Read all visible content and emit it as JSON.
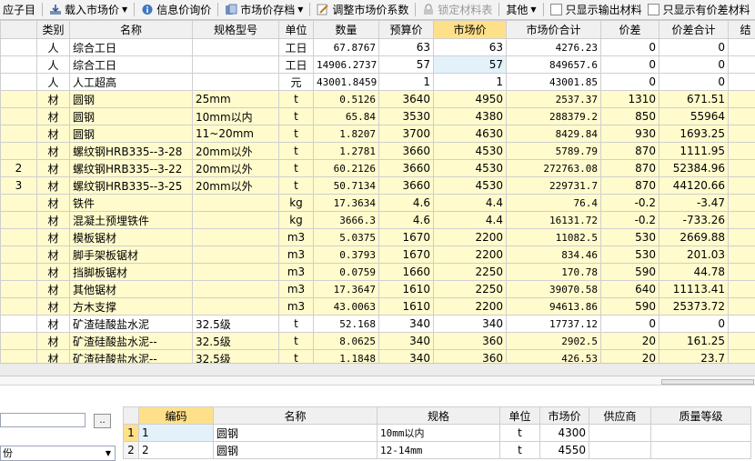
{
  "toolbar": {
    "item_left": "应子目",
    "load_price": "载入市场价",
    "info_price": "信息价询价",
    "market_archive": "市场价存档",
    "adjust_coef": "调整市场价系数",
    "lock_table": "锁定材料表",
    "other": "其他",
    "only_output": "只显示输出材料",
    "only_diff": "只显示有价差材料"
  },
  "grid": {
    "headers": [
      "类别",
      "名称",
      "规格型号",
      "单位",
      "数量",
      "预算价",
      "市场价",
      "市场价合计",
      "价差",
      "价差合计",
      "结"
    ],
    "rows": [
      {
        "lead": "",
        "cat": "人",
        "name": "综合工日",
        "spec": "",
        "unit": "工日",
        "qty": "67.8767",
        "budget": "63",
        "market": "63",
        "total": "4276.23",
        "diff": "0",
        "diff_total": "0",
        "tone": "white"
      },
      {
        "lead": "",
        "cat": "人",
        "name": "综合工日",
        "spec": "",
        "unit": "工日",
        "qty": "14906.2737",
        "budget": "57",
        "market": "57",
        "total": "849657.6",
        "diff": "0",
        "diff_total": "0",
        "tone": "white"
      },
      {
        "lead": "",
        "cat": "人",
        "name": "人工超高",
        "spec": "",
        "unit": "元",
        "qty": "43001.8459",
        "budget": "1",
        "market": "1",
        "total": "43001.85",
        "diff": "0",
        "diff_total": "0",
        "tone": "white"
      },
      {
        "lead": "",
        "cat": "材",
        "name": "圆钢",
        "spec": "25mm",
        "unit": "t",
        "qty": "0.5126",
        "budget": "3640",
        "market": "4950",
        "total": "2537.37",
        "diff": "1310",
        "diff_total": "671.51",
        "tone": "yellow"
      },
      {
        "lead": "",
        "cat": "材",
        "name": "圆钢",
        "spec": "10mm以内",
        "unit": "t",
        "qty": "65.84",
        "budget": "3530",
        "market": "4380",
        "total": "288379.2",
        "diff": "850",
        "diff_total": "55964",
        "tone": "yellow"
      },
      {
        "lead": "",
        "cat": "材",
        "name": "圆钢",
        "spec": "11~20mm",
        "unit": "t",
        "qty": "1.8207",
        "budget": "3700",
        "market": "4630",
        "total": "8429.84",
        "diff": "930",
        "diff_total": "1693.25",
        "tone": "yellow"
      },
      {
        "lead": "",
        "cat": "材",
        "name": "螺纹钢HRB335--3-28",
        "spec": "20mm以外",
        "unit": "t",
        "qty": "1.2781",
        "budget": "3660",
        "market": "4530",
        "total": "5789.79",
        "diff": "870",
        "diff_total": "1111.95",
        "tone": "yellow"
      },
      {
        "lead": "2",
        "cat": "材",
        "name": "螺纹钢HRB335--3-22",
        "spec": "20mm以外",
        "unit": "t",
        "qty": "60.2126",
        "budget": "3660",
        "market": "4530",
        "total": "272763.08",
        "diff": "870",
        "diff_total": "52384.96",
        "tone": "yellow"
      },
      {
        "lead": "3",
        "cat": "材",
        "name": "螺纹钢HRB335--3-25",
        "spec": "20mm以外",
        "unit": "t",
        "qty": "50.7134",
        "budget": "3660",
        "market": "4530",
        "total": "229731.7",
        "diff": "870",
        "diff_total": "44120.66",
        "tone": "yellow"
      },
      {
        "lead": "",
        "cat": "材",
        "name": "铁件",
        "spec": "",
        "unit": "kg",
        "qty": "17.3634",
        "budget": "4.6",
        "market": "4.4",
        "total": "76.4",
        "diff": "-0.2",
        "diff_total": "-3.47",
        "tone": "yellow"
      },
      {
        "lead": "",
        "cat": "材",
        "name": "混凝土预埋铁件",
        "spec": "",
        "unit": "kg",
        "qty": "3666.3",
        "budget": "4.6",
        "market": "4.4",
        "total": "16131.72",
        "diff": "-0.2",
        "diff_total": "-733.26",
        "tone": "yellow"
      },
      {
        "lead": "",
        "cat": "材",
        "name": "模板锯材",
        "spec": "",
        "unit": "m3",
        "qty": "5.0375",
        "budget": "1670",
        "market": "2200",
        "total": "11082.5",
        "diff": "530",
        "diff_total": "2669.88",
        "tone": "yellow"
      },
      {
        "lead": "",
        "cat": "材",
        "name": "脚手架板锯材",
        "spec": "",
        "unit": "m3",
        "qty": "0.3793",
        "budget": "1670",
        "market": "2200",
        "total": "834.46",
        "diff": "530",
        "diff_total": "201.03",
        "tone": "yellow"
      },
      {
        "lead": "",
        "cat": "材",
        "name": "挡脚板锯材",
        "spec": "",
        "unit": "m3",
        "qty": "0.0759",
        "budget": "1660",
        "market": "2250",
        "total": "170.78",
        "diff": "590",
        "diff_total": "44.78",
        "tone": "yellow"
      },
      {
        "lead": "",
        "cat": "材",
        "name": "其他锯材",
        "spec": "",
        "unit": "m3",
        "qty": "17.3647",
        "budget": "1610",
        "market": "2250",
        "total": "39070.58",
        "diff": "640",
        "diff_total": "11113.41",
        "tone": "yellow"
      },
      {
        "lead": "",
        "cat": "材",
        "name": "方木支撑",
        "spec": "",
        "unit": "m3",
        "qty": "43.0063",
        "budget": "1610",
        "market": "2200",
        "total": "94613.86",
        "diff": "590",
        "diff_total": "25373.72",
        "tone": "yellow"
      },
      {
        "lead": "",
        "cat": "材",
        "name": "矿渣硅酸盐水泥",
        "spec": "32.5级",
        "unit": "t",
        "qty": "52.168",
        "budget": "340",
        "market": "340",
        "total": "17737.12",
        "diff": "0",
        "diff_total": "0",
        "tone": "white"
      },
      {
        "lead": "",
        "cat": "材",
        "name": "矿渣硅酸盐水泥--",
        "spec": "32.5级",
        "unit": "t",
        "qty": "8.0625",
        "budget": "340",
        "market": "360",
        "total": "2902.5",
        "diff": "20",
        "diff_total": "161.25",
        "tone": "yellow"
      },
      {
        "lead": "",
        "cat": "材",
        "name": "矿渣硅酸盐水泥--",
        "spec": "32.5级",
        "unit": "t",
        "qty": "1.1848",
        "budget": "340",
        "market": "360",
        "total": "426.53",
        "diff": "20",
        "diff_total": "23.7",
        "tone": "yellow"
      }
    ]
  },
  "bottom": {
    "search_value": "",
    "browse_label": "..",
    "combo_value": "份",
    "headers": [
      "编码",
      "名称",
      "规格",
      "单位",
      "市场价",
      "供应商",
      "质量等级"
    ],
    "rows": [
      {
        "num": "1",
        "code": "1",
        "name": "圆钢",
        "spec": "10mm以内",
        "unit": "t",
        "price": "4300",
        "supplier": "",
        "grade": ""
      },
      {
        "num": "2",
        "code": "2",
        "name": "圆钢",
        "spec": "12-14mm",
        "unit": "t",
        "price": "4550",
        "supplier": "",
        "grade": ""
      }
    ]
  },
  "colors": {
    "row_yellow": "#fffbcc",
    "header_active": "#ffe08a",
    "cell_selected": "#e3f1fb"
  }
}
